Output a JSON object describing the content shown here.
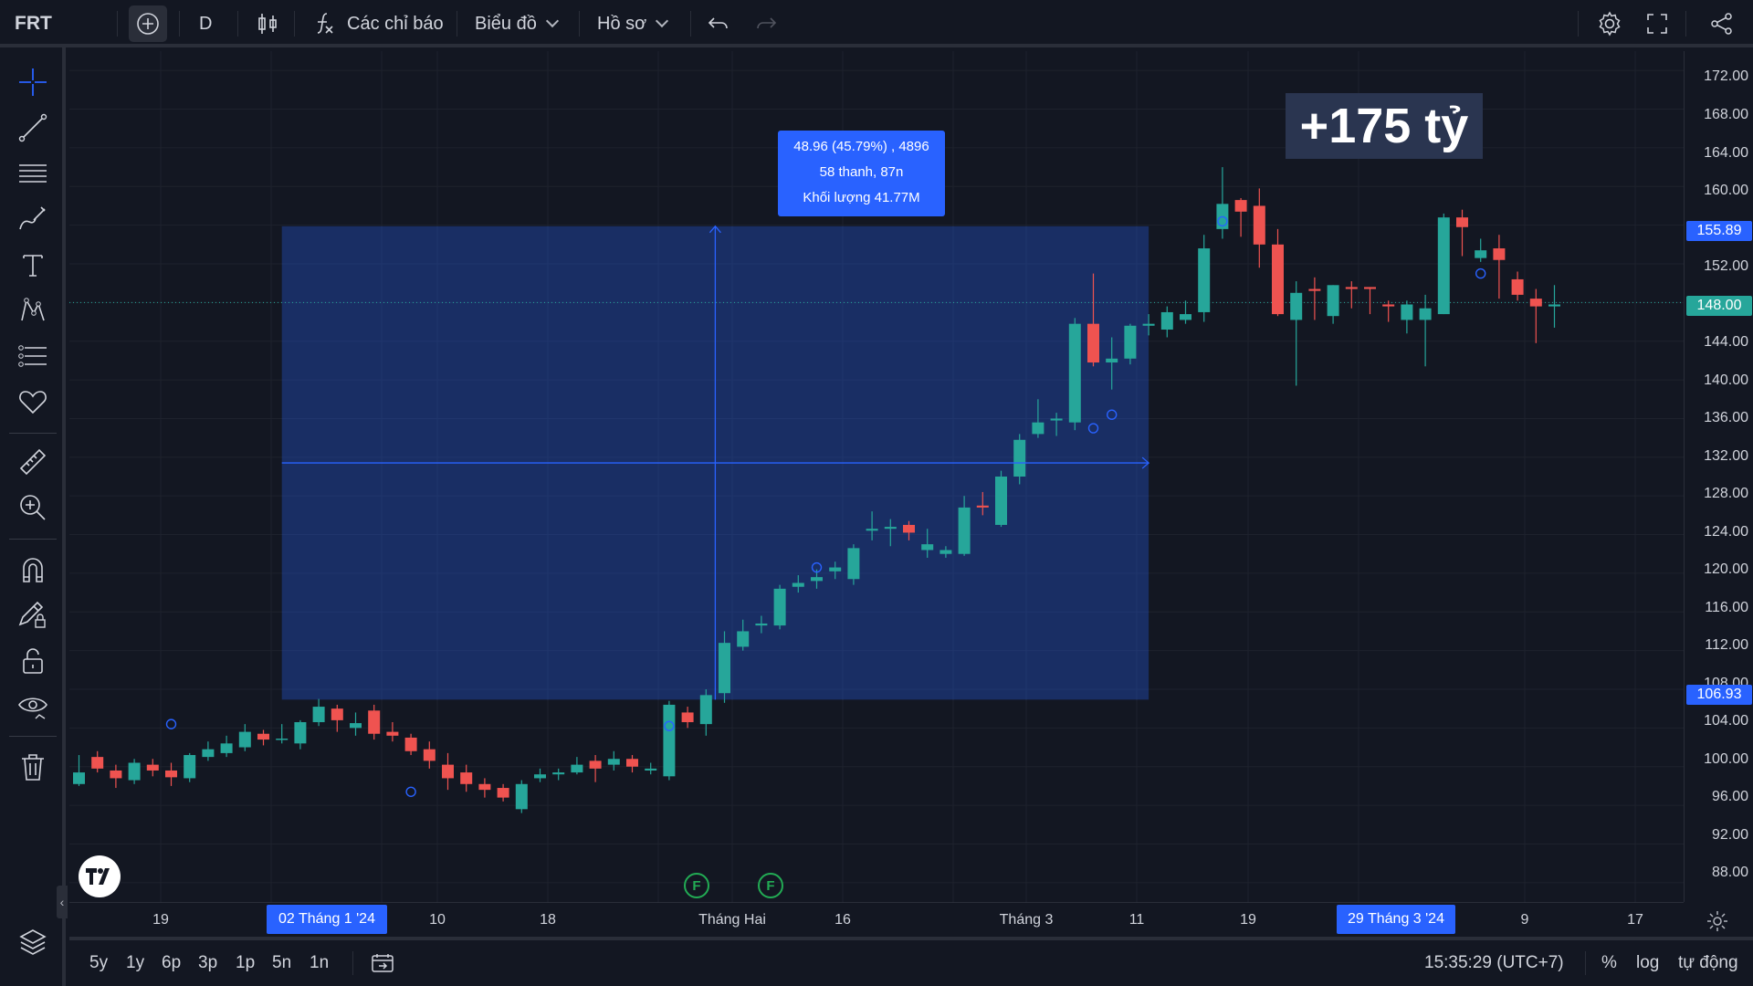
{
  "toolbar": {
    "symbol": "FRT",
    "interval": "D",
    "indicators_label": "Các chỉ báo",
    "chart_menu_label": "Biểu đồ",
    "profile_menu_label": "Hồ sơ"
  },
  "overlay": {
    "tooltip_line1": "48.96 (45.79%) , 4896",
    "tooltip_line2": "58 thanh, 87n",
    "tooltip_line3": "Khối lượng 41.77M",
    "annotation": "+175 tỷ"
  },
  "price_axis": {
    "labels": [
      "172.00",
      "168.00",
      "164.00",
      "160.00",
      "152.00",
      "144.00",
      "140.00",
      "136.00",
      "132.00",
      "128.00",
      "124.00",
      "120.00",
      "116.00",
      "112.00",
      "108.00",
      "104.00",
      "100.00",
      "96.00",
      "92.00",
      "88.00"
    ],
    "tag_top": "155.89",
    "tag_current": "148.00",
    "tag_bottom": "106.93"
  },
  "time_axis": {
    "labels": [
      "19",
      "10",
      "18",
      "Tháng Hai",
      "16",
      "Tháng 3",
      "11",
      "19",
      "9",
      "17"
    ],
    "tag_start": "02 Tháng 1 '24",
    "tag_end": "29 Tháng 3 '24"
  },
  "event_markers": [
    "F",
    "F"
  ],
  "bottombar": {
    "ranges": [
      "5y",
      "1y",
      "6p",
      "3p",
      "1p",
      "5n",
      "1n"
    ],
    "clock": "15:35:29 (UTC+7)",
    "percent_label": "%",
    "log_label": "log",
    "auto_label": "tự động"
  },
  "colors": {
    "up": "#26a69a",
    "down": "#ef5350",
    "accent": "#2962ff",
    "background": "#131722"
  },
  "chart_data": {
    "type": "candlestick",
    "symbol": "FRT",
    "ylim": [
      86,
      174
    ],
    "y_ticks": [
      88,
      92,
      96,
      100,
      104,
      108,
      112,
      116,
      120,
      124,
      128,
      132,
      136,
      140,
      144,
      148,
      152,
      156,
      160,
      164,
      168,
      172
    ],
    "current_price": 148.0,
    "measure": {
      "from": 106.93,
      "to": 155.89,
      "change": 48.96,
      "percent": 45.79,
      "bars": 58,
      "days": 87,
      "volume": "41.77M"
    },
    "candles": [
      [
        98.2,
        99.4,
        101.2,
        98.0
      ],
      [
        101.0,
        99.8,
        101.6,
        99.4
      ],
      [
        99.6,
        98.8,
        100.2,
        97.8
      ],
      [
        98.6,
        100.4,
        100.8,
        98.2
      ],
      [
        100.2,
        99.6,
        100.8,
        99.0
      ],
      [
        99.6,
        98.9,
        100.4,
        98.0
      ],
      [
        98.8,
        101.2,
        101.4,
        98.4
      ],
      [
        101.0,
        101.8,
        102.6,
        100.6
      ],
      [
        101.4,
        102.4,
        103.2,
        101.0
      ],
      [
        102.0,
        103.6,
        104.4,
        101.6
      ],
      [
        103.4,
        102.8,
        103.8,
        102.2
      ],
      [
        102.8,
        102.9,
        104.4,
        102.4
      ],
      [
        102.4,
        104.6,
        104.8,
        101.8
      ],
      [
        104.6,
        106.2,
        107.0,
        104.2
      ],
      [
        106.0,
        104.8,
        106.4,
        103.6
      ],
      [
        104.0,
        104.5,
        105.6,
        103.2
      ],
      [
        105.8,
        103.4,
        106.4,
        102.8
      ],
      [
        103.6,
        103.2,
        104.6,
        102.6
      ],
      [
        103.0,
        101.6,
        103.4,
        101.2
      ],
      [
        101.8,
        100.6,
        102.6,
        99.8
      ],
      [
        100.2,
        98.8,
        101.4,
        97.6
      ],
      [
        99.4,
        98.2,
        100.2,
        97.4
      ],
      [
        98.2,
        97.6,
        98.8,
        96.8
      ],
      [
        97.8,
        96.8,
        98.2,
        96.4
      ],
      [
        95.6,
        98.2,
        98.6,
        95.2
      ],
      [
        98.8,
        99.2,
        99.8,
        98.4
      ],
      [
        99.2,
        99.4,
        99.8,
        98.6
      ],
      [
        99.4,
        100.2,
        101.0,
        99.2
      ],
      [
        100.6,
        99.8,
        101.2,
        98.4
      ],
      [
        100.2,
        100.8,
        101.6,
        99.6
      ],
      [
        100.8,
        100.0,
        101.2,
        99.4
      ],
      [
        99.6,
        99.8,
        100.4,
        99.2
      ],
      [
        99.0,
        106.4,
        106.8,
        98.6
      ],
      [
        105.6,
        104.6,
        106.2,
        104.0
      ],
      [
        104.4,
        107.4,
        108.0,
        103.2
      ],
      [
        107.6,
        112.8,
        114.0,
        106.6
      ],
      [
        112.4,
        114.0,
        115.2,
        112.0
      ],
      [
        114.6,
        114.8,
        115.6,
        113.8
      ],
      [
        114.6,
        118.4,
        118.8,
        114.2
      ],
      [
        118.6,
        119.0,
        119.8,
        118.0
      ],
      [
        119.2,
        119.6,
        120.4,
        118.4
      ],
      [
        120.2,
        120.6,
        121.2,
        119.4
      ],
      [
        119.4,
        122.6,
        123.0,
        118.8
      ],
      [
        124.4,
        124.6,
        126.4,
        123.4
      ],
      [
        124.6,
        124.8,
        125.6,
        122.8
      ],
      [
        125.0,
        124.2,
        125.4,
        123.4
      ],
      [
        122.4,
        123.0,
        124.6,
        121.6
      ],
      [
        122.0,
        122.4,
        122.8,
        121.6
      ],
      [
        122.0,
        126.8,
        128.0,
        121.8
      ],
      [
        127.0,
        126.8,
        128.4,
        126.0
      ],
      [
        125.0,
        130.0,
        130.6,
        124.8
      ],
      [
        130.0,
        133.8,
        134.4,
        129.2
      ],
      [
        134.4,
        135.6,
        138.0,
        134.0
      ],
      [
        135.8,
        136.0,
        136.6,
        134.2
      ],
      [
        135.6,
        145.8,
        146.4,
        134.8
      ],
      [
        145.8,
        141.8,
        151.0,
        141.4
      ],
      [
        141.8,
        142.2,
        144.4,
        139.0
      ],
      [
        142.2,
        145.6,
        145.8,
        141.6
      ],
      [
        145.6,
        145.8,
        146.8,
        144.6
      ],
      [
        145.2,
        147.0,
        147.6,
        144.4
      ],
      [
        146.2,
        146.8,
        148.2,
        145.8
      ],
      [
        147.0,
        153.6,
        155.0,
        146.0
      ],
      [
        155.6,
        158.2,
        162.0,
        154.6
      ],
      [
        158.6,
        157.4,
        158.8,
        154.8
      ],
      [
        158.0,
        154.0,
        159.8,
        151.6
      ],
      [
        154.0,
        146.8,
        155.6,
        146.6
      ],
      [
        146.2,
        149.0,
        150.2,
        139.4
      ],
      [
        149.4,
        149.2,
        150.6,
        146.2
      ],
      [
        146.6,
        149.8,
        149.8,
        145.8
      ],
      [
        149.6,
        149.4,
        150.2,
        147.4
      ],
      [
        149.6,
        149.4,
        149.6,
        146.8
      ],
      [
        147.8,
        147.6,
        148.2,
        146.0
      ],
      [
        146.2,
        147.8,
        148.2,
        144.8
      ],
      [
        146.2,
        147.4,
        148.8,
        141.4
      ],
      [
        146.8,
        156.8,
        157.2,
        146.8
      ],
      [
        156.8,
        155.8,
        157.6,
        152.8
      ],
      [
        152.6,
        153.4,
        154.6,
        152.2
      ],
      [
        153.6,
        152.4,
        155.0,
        148.4
      ],
      [
        150.4,
        148.8,
        151.2,
        148.2
      ],
      [
        148.4,
        147.6,
        149.4,
        143.8
      ],
      [
        147.6,
        147.8,
        149.8,
        145.4
      ]
    ]
  }
}
